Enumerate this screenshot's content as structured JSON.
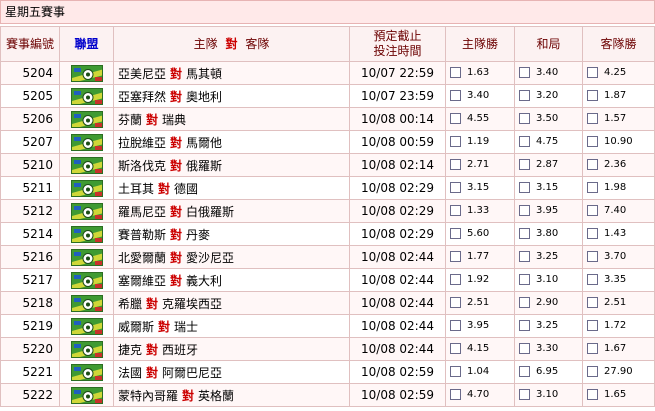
{
  "page_title": "星期五賽事",
  "colors": {
    "vs": "#cc0000",
    "header_text": "#6b0000",
    "league_header": "#0000cc"
  },
  "headers": {
    "no": "賽事編號",
    "league": "聯盟",
    "home": "主隊",
    "vs": "對",
    "away": "客隊",
    "time_line1": "預定截止",
    "time_line2": "投注時間",
    "home_win": "主隊勝",
    "draw": "和局",
    "away_win": "客隊勝"
  },
  "league_icon": "league-badge-icon",
  "rows": [
    {
      "no": "5204",
      "home": "亞美尼亞",
      "away": "馬其頓",
      "time": "10/07 22:59",
      "h": "1.63",
      "d": "3.40",
      "a": "4.25"
    },
    {
      "no": "5205",
      "home": "亞塞拜然",
      "away": "奧地利",
      "time": "10/07 23:59",
      "h": "3.40",
      "d": "3.20",
      "a": "1.87"
    },
    {
      "no": "5206",
      "home": "芬蘭",
      "away": "瑞典",
      "time": "10/08 00:14",
      "h": "4.55",
      "d": "3.50",
      "a": "1.57"
    },
    {
      "no": "5207",
      "home": "拉脫維亞",
      "away": "馬爾他",
      "time": "10/08 00:59",
      "h": "1.19",
      "d": "4.75",
      "a": "10.90"
    },
    {
      "no": "5210",
      "home": "斯洛伐克",
      "away": "俄羅斯",
      "time": "10/08 02:14",
      "h": "2.71",
      "d": "2.87",
      "a": "2.36"
    },
    {
      "no": "5211",
      "home": "土耳其",
      "away": "德國",
      "time": "10/08 02:29",
      "h": "3.15",
      "d": "3.15",
      "a": "1.98"
    },
    {
      "no": "5212",
      "home": "羅馬尼亞",
      "away": "白俄羅斯",
      "time": "10/08 02:29",
      "h": "1.33",
      "d": "3.95",
      "a": "7.40"
    },
    {
      "no": "5214",
      "home": "賽普勒斯",
      "away": "丹麥",
      "time": "10/08 02:29",
      "h": "5.60",
      "d": "3.80",
      "a": "1.43"
    },
    {
      "no": "5216",
      "home": "北愛爾蘭",
      "away": "愛沙尼亞",
      "time": "10/08 02:44",
      "h": "1.77",
      "d": "3.25",
      "a": "3.70"
    },
    {
      "no": "5217",
      "home": "塞爾維亞",
      "away": "義大利",
      "time": "10/08 02:44",
      "h": "1.92",
      "d": "3.10",
      "a": "3.35"
    },
    {
      "no": "5218",
      "home": "希臘",
      "away": "克羅埃西亞",
      "time": "10/08 02:44",
      "h": "2.51",
      "d": "2.90",
      "a": "2.51"
    },
    {
      "no": "5219",
      "home": "威爾斯",
      "away": "瑞士",
      "time": "10/08 02:44",
      "h": "3.95",
      "d": "3.25",
      "a": "1.72"
    },
    {
      "no": "5220",
      "home": "捷克",
      "away": "西班牙",
      "time": "10/08 02:44",
      "h": "4.15",
      "d": "3.30",
      "a": "1.67"
    },
    {
      "no": "5221",
      "home": "法國",
      "away": "阿爾巴尼亞",
      "time": "10/08 02:59",
      "h": "1.04",
      "d": "6.95",
      "a": "27.90"
    },
    {
      "no": "5222",
      "home": "蒙特內哥羅",
      "away": "英格蘭",
      "time": "10/08 02:59",
      "h": "4.70",
      "d": "3.10",
      "a": "1.65"
    }
  ]
}
